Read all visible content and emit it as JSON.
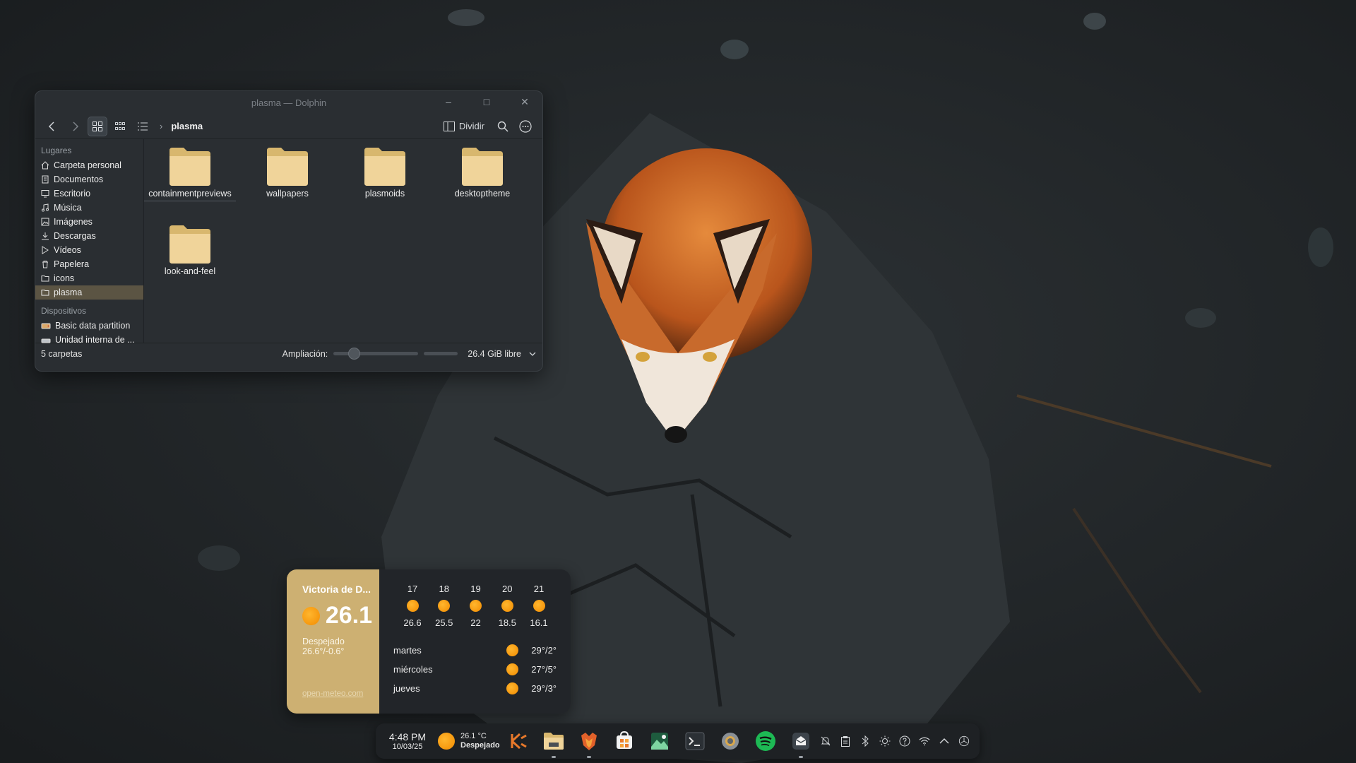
{
  "window": {
    "title": "plasma — Dolphin",
    "breadcrumb": "plasma",
    "split_label": "Dividir",
    "sidebar": {
      "places_heading": "Lugares",
      "places": [
        {
          "label": "Carpeta personal",
          "icon": "home-icon"
        },
        {
          "label": "Documentos",
          "icon": "document-icon"
        },
        {
          "label": "Escritorio",
          "icon": "desktop-icon"
        },
        {
          "label": "Música",
          "icon": "music-icon"
        },
        {
          "label": "Imágenes",
          "icon": "image-icon"
        },
        {
          "label": "Descargas",
          "icon": "download-icon"
        },
        {
          "label": "Vídeos",
          "icon": "video-icon"
        },
        {
          "label": "Papelera",
          "icon": "trash-icon"
        },
        {
          "label": "icons",
          "icon": "folder-icon"
        },
        {
          "label": "plasma",
          "icon": "folder-icon",
          "selected": true
        }
      ],
      "devices_heading": "Dispositivos",
      "devices": [
        {
          "label": "Basic data partition",
          "icon": "drive-icon"
        },
        {
          "label": "Unidad interna de ...",
          "icon": "drive-icon"
        }
      ]
    },
    "folders": [
      {
        "label": "containmentpreviews"
      },
      {
        "label": "wallpapers"
      },
      {
        "label": "plasmoids"
      },
      {
        "label": "desktoptheme"
      },
      {
        "label": "look-and-feel"
      }
    ],
    "status": {
      "count": "5 carpetas",
      "zoom_label": "Ampliación:",
      "zoom_level": 0.2,
      "free_space": "26.4 GiB libre"
    }
  },
  "weather": {
    "city": "Victoria de D...",
    "current_temp": "26.1",
    "condition": "Despejado",
    "range": "26.6°/-0.6°",
    "source": "open-meteo.com",
    "hourly": [
      {
        "hour": "17",
        "temp": "26.6"
      },
      {
        "hour": "18",
        "temp": "25.5"
      },
      {
        "hour": "19",
        "temp": "22"
      },
      {
        "hour": "20",
        "temp": "18.5"
      },
      {
        "hour": "21",
        "temp": "16.1"
      }
    ],
    "daily": [
      {
        "day": "martes",
        "temps": "29°/2°"
      },
      {
        "day": "miércoles",
        "temps": "27°/5°"
      },
      {
        "day": "jueves",
        "temps": "29°/3°"
      }
    ]
  },
  "taskbar": {
    "time": "4:48 PM",
    "date": "10/03/25",
    "weather_temp": "26.1 °C",
    "weather_cond": "Despejado",
    "apps": [
      "kde-app-menu-icon",
      "dolphin-file-manager-icon",
      "firefox-icon",
      "discover-store-icon",
      "image-viewer-icon",
      "terminal-icon",
      "settings-icon",
      "spotify-icon",
      "mail-client-icon"
    ],
    "tray": [
      "notifications-icon",
      "clipboard-icon",
      "bluetooth-icon",
      "brightness-icon",
      "help-icon",
      "wifi-icon",
      "expand-tray-icon",
      "power-icon"
    ]
  }
}
